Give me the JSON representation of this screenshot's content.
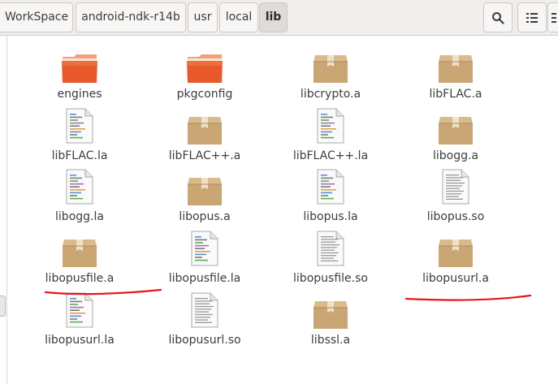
{
  "breadcrumb": {
    "segments": [
      "WorkSpace",
      "android-ndk-r14b",
      "usr",
      "local",
      "lib"
    ],
    "active": "lib"
  },
  "toolbar": {
    "search_icon": "search-icon",
    "view_icon": "list-view-icon",
    "menu_icon": "menu-icon"
  },
  "colors": {
    "folder": "#e8582a",
    "package": "#c9a673",
    "annotation": "#e8151c"
  },
  "files": [
    {
      "name": "engines",
      "type": "folder"
    },
    {
      "name": "pkgconfig",
      "type": "folder"
    },
    {
      "name": "libcrypto.a",
      "type": "package"
    },
    {
      "name": "libFLAC.a",
      "type": "package"
    },
    {
      "name": "libFLAC.la",
      "type": "script"
    },
    {
      "name": "libFLAC++.a",
      "type": "package"
    },
    {
      "name": "libFLAC++.la",
      "type": "script"
    },
    {
      "name": "libogg.a",
      "type": "package"
    },
    {
      "name": "libogg.la",
      "type": "script"
    },
    {
      "name": "libopus.a",
      "type": "package"
    },
    {
      "name": "libopus.la",
      "type": "script"
    },
    {
      "name": "libopus.so",
      "type": "text"
    },
    {
      "name": "libopusfile.a",
      "type": "package",
      "underlined": true
    },
    {
      "name": "libopusfile.la",
      "type": "script"
    },
    {
      "name": "libopusfile.so",
      "type": "text"
    },
    {
      "name": "libopusurl.a",
      "type": "package",
      "underlined": true
    },
    {
      "name": "libopusurl.la",
      "type": "script"
    },
    {
      "name": "libopusurl.so",
      "type": "text"
    },
    {
      "name": "libssl.a",
      "type": "package"
    }
  ]
}
